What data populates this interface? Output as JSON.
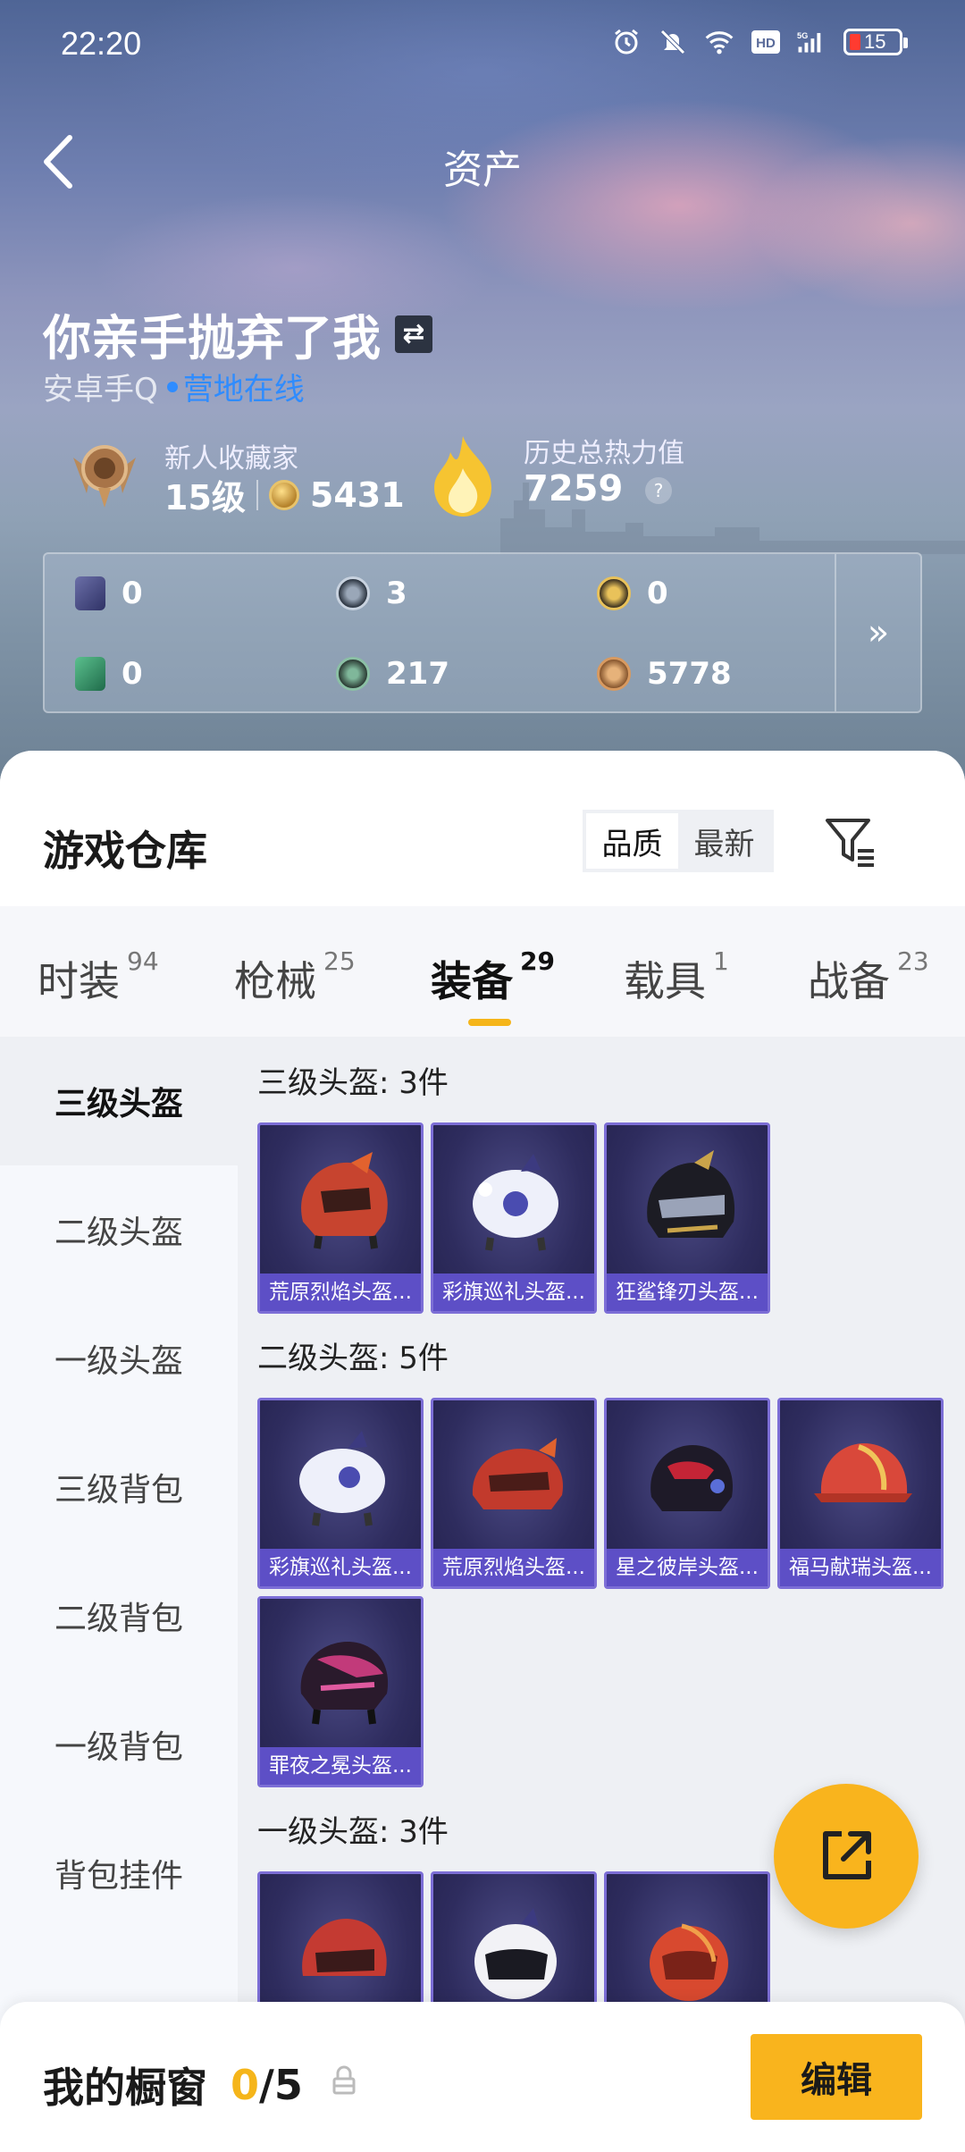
{
  "status_bar": {
    "time": "22:20",
    "battery": "15"
  },
  "header": {
    "title": "资产"
  },
  "profile": {
    "name": "你亲手抛弃了我",
    "platform": "安卓手Q",
    "online_status": "营地在线",
    "rank_title": "新人收藏家",
    "level": "15级",
    "coins": "5431",
    "heat_label": "历史总热力值",
    "heat_value": "7259",
    "help": "?"
  },
  "currencies": {
    "c1": "0",
    "c2": "3",
    "c3": "0",
    "c4": "0",
    "c5": "217",
    "c6": "5778",
    "more": "»"
  },
  "warehouse": {
    "title": "游戏仓库",
    "sort_quality": "品质",
    "sort_newest": "最新"
  },
  "tabs": [
    {
      "label": "时装",
      "count": "94"
    },
    {
      "label": "枪械",
      "count": "25"
    },
    {
      "label": "装备",
      "count": "29"
    },
    {
      "label": "载具",
      "count": "1"
    },
    {
      "label": "战备",
      "count": "23"
    }
  ],
  "sidebar": [
    "三级头盔",
    "二级头盔",
    "一级头盔",
    "三级背包",
    "二级背包",
    "一级背包",
    "背包挂件"
  ],
  "sections": {
    "s1": {
      "title": "三级头盔: 3件",
      "items": [
        "荒原烈焰头盔...",
        "彩旗巡礼头盔...",
        "狂鲨锋刃头盔..."
      ]
    },
    "s2": {
      "title": "二级头盔: 5件",
      "items": [
        "彩旗巡礼头盔...",
        "荒原烈焰头盔...",
        "星之彼岸头盔...",
        "福马献瑞头盔...",
        "罪夜之冕头盔..."
      ]
    },
    "s3": {
      "title": "一级头盔: 3件"
    }
  },
  "showcase": {
    "title": "我的橱窗",
    "count_current": "0",
    "count_total": "/5",
    "edit_label": "编辑"
  },
  "colors": {
    "accent": "#f9b41d",
    "card_label": "#5d4fc6",
    "online": "#2f8cff"
  }
}
